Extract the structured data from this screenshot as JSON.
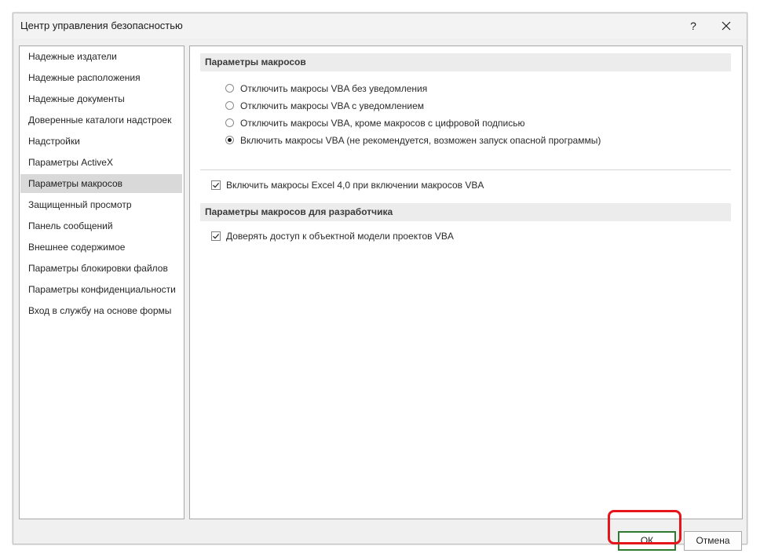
{
  "window": {
    "title": "Центр управления безопасностью",
    "help_label": "?"
  },
  "sidebar": {
    "items": [
      {
        "label": "Надежные издатели",
        "selected": false
      },
      {
        "label": "Надежные расположения",
        "selected": false
      },
      {
        "label": "Надежные документы",
        "selected": false
      },
      {
        "label": "Доверенные каталоги надстроек",
        "selected": false
      },
      {
        "label": "Надстройки",
        "selected": false
      },
      {
        "label": "Параметры ActiveX",
        "selected": false
      },
      {
        "label": "Параметры макросов",
        "selected": true
      },
      {
        "label": "Защищенный просмотр",
        "selected": false
      },
      {
        "label": "Панель сообщений",
        "selected": false
      },
      {
        "label": "Внешнее содержимое",
        "selected": false
      },
      {
        "label": "Параметры блокировки файлов",
        "selected": false
      },
      {
        "label": "Параметры конфиденциальности",
        "selected": false
      },
      {
        "label": "Вход в службу на основе формы",
        "selected": false
      }
    ]
  },
  "macro_settings": {
    "header": "Параметры макросов",
    "options": [
      {
        "label": "Отключить макросы VBA без уведомления",
        "selected": false
      },
      {
        "label": "Отключить макросы VBA с уведомлением",
        "selected": false
      },
      {
        "label": "Отключить макросы VBA, кроме макросов с цифровой подписью",
        "selected": false
      },
      {
        "label": "Включить макросы VBA (не рекомендуется, возможен запуск опасной программы)",
        "selected": true
      }
    ],
    "excel4_checkbox": {
      "label": "Включить макросы Excel 4,0 при включении макросов VBA",
      "checked": true
    }
  },
  "developer_settings": {
    "header": "Параметры макросов для разработчика",
    "trust_vba_checkbox": {
      "label": "Доверять доступ к объектной модели проектов VBA",
      "checked": true
    }
  },
  "footer": {
    "ok_label": "ОК",
    "cancel_label": "Отмена"
  },
  "colors": {
    "highlight": "#e4161c",
    "ok_border": "#2e7a2e",
    "selected_nav": "#d9d9d9"
  },
  "icons": {
    "help": "question-mark",
    "close": "x-icon",
    "radio_selected": "radio-dot",
    "checkbox_checked": "check-mark"
  }
}
